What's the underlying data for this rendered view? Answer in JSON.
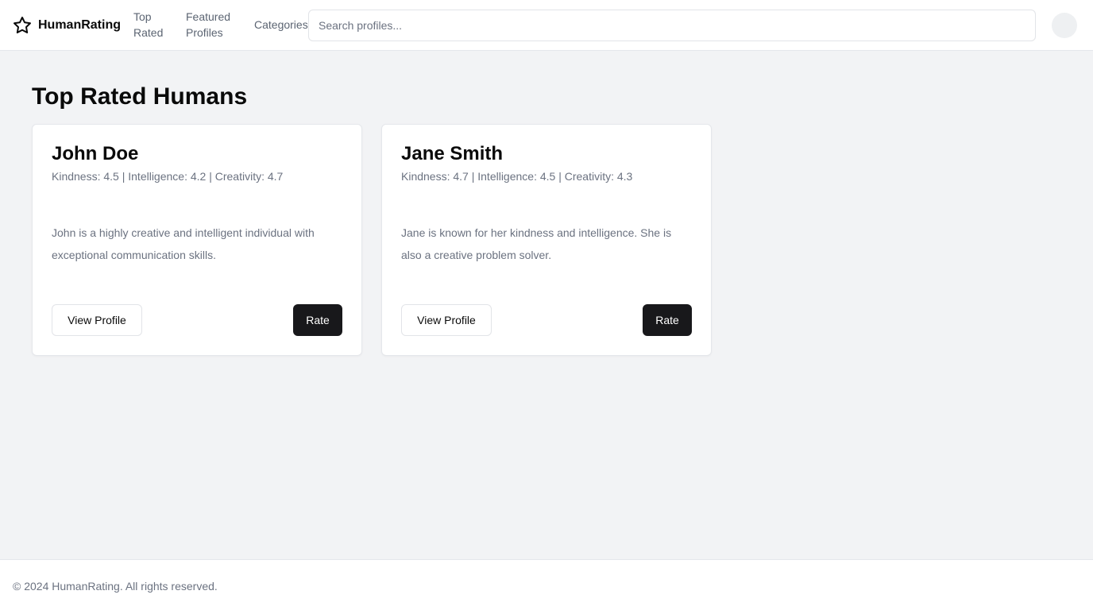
{
  "header": {
    "logo_icon": "star-icon",
    "brand": "HumanRating",
    "nav": [
      {
        "label": "Top Rated"
      },
      {
        "label": "Featured Profiles"
      },
      {
        "label": "Categories"
      }
    ],
    "search_placeholder": "Search profiles...",
    "search_value": ""
  },
  "main": {
    "title": "Top Rated Humans",
    "cards": [
      {
        "name": "John Doe",
        "stats": "Kindness: 4.5 | Intelligence: 4.2 | Creativity: 4.7",
        "description": "John is a highly creative and intelligent individual with exceptional communication skills.",
        "view_label": "View Profile",
        "rate_label": "Rate"
      },
      {
        "name": "Jane Smith",
        "stats": "Kindness: 4.7 | Intelligence: 4.5 | Creativity: 4.3",
        "description": "Jane is known for her kindness and intelligence. She is also a creative problem solver.",
        "view_label": "View Profile",
        "rate_label": "Rate"
      }
    ]
  },
  "footer": {
    "text": "© 2024 HumanRating. All rights reserved."
  },
  "colors": {
    "background": "#f2f3f5",
    "primary_button": "#18181b",
    "muted_text": "#6b7280"
  }
}
